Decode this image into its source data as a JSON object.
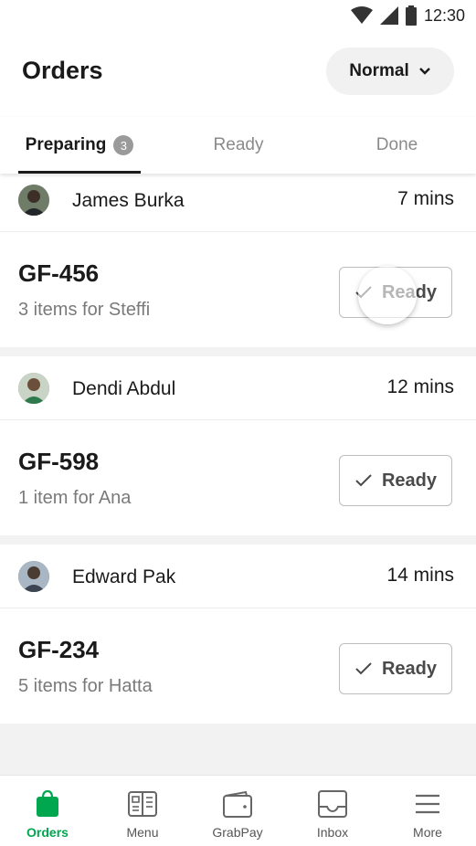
{
  "status_bar": {
    "time": "12:30"
  },
  "header": {
    "title": "Orders",
    "mode_selector": {
      "value": "Normal"
    }
  },
  "tabs": [
    {
      "label": "Preparing",
      "badge": "3"
    },
    {
      "label": "Ready"
    },
    {
      "label": "Done"
    }
  ],
  "orders": [
    {
      "customer": "James Burka",
      "wait": "7 mins",
      "id": "GF-456",
      "summary": "3 items for Steffi",
      "action": "Ready"
    },
    {
      "customer": "Dendi Abdul",
      "wait": "12 mins",
      "id": "GF-598",
      "summary": "1 item for Ana",
      "action": "Ready"
    },
    {
      "customer": "Edward Pak",
      "wait": "14 mins",
      "id": "GF-234",
      "summary": "5 items for Hatta",
      "action": "Ready"
    }
  ],
  "bottom_nav": [
    {
      "label": "Orders",
      "icon": "shopping-bag-icon"
    },
    {
      "label": "Menu",
      "icon": "menu-book-icon"
    },
    {
      "label": "GrabPay",
      "icon": "wallet-icon"
    },
    {
      "label": "Inbox",
      "icon": "inbox-icon"
    },
    {
      "label": "More",
      "icon": "hamburger-icon"
    }
  ],
  "colors": {
    "brand_green": "#00a74f",
    "badge_grey": "#9a9a9a",
    "list_background": "#f2f2f2"
  }
}
